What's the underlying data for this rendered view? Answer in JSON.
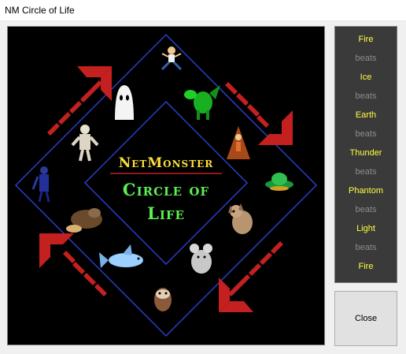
{
  "window": {
    "title": "NM Circle of Life"
  },
  "logo": {
    "line1": "NetMonster",
    "line2": "Circle of",
    "line3": "Life"
  },
  "cycle": [
    {
      "label": "Fire",
      "kind": "element"
    },
    {
      "label": "beats",
      "kind": "beats"
    },
    {
      "label": "Ice",
      "kind": "element"
    },
    {
      "label": "beats",
      "kind": "beats"
    },
    {
      "label": "Earth",
      "kind": "element"
    },
    {
      "label": "beats",
      "kind": "beats"
    },
    {
      "label": "Thunder",
      "kind": "element"
    },
    {
      "label": "beats",
      "kind": "beats"
    },
    {
      "label": "Phantom",
      "kind": "element"
    },
    {
      "label": "beats",
      "kind": "beats"
    },
    {
      "label": "Light",
      "kind": "element"
    },
    {
      "label": "beats",
      "kind": "beats"
    },
    {
      "label": "Fire",
      "kind": "element"
    }
  ],
  "buttons": {
    "close_label": "Close"
  },
  "colors": {
    "element_text": "#ffff40",
    "beats_text": "#8c8c8c",
    "logo_top": "#ffdf3a",
    "logo_bottom": "#5cf050",
    "diamond_border": "#2b3fc8",
    "arrow": "#c42020"
  },
  "monsters": [
    "jumping-kid-monster",
    "green-dragon-monster",
    "wizard-monster",
    "flying-saucer-monster",
    "puppy-monster",
    "mouse-monster",
    "owl-monster",
    "flying-fish-monster",
    "mole-monster",
    "blue-knight-monster",
    "mummy-monster",
    "ghost-monster"
  ]
}
